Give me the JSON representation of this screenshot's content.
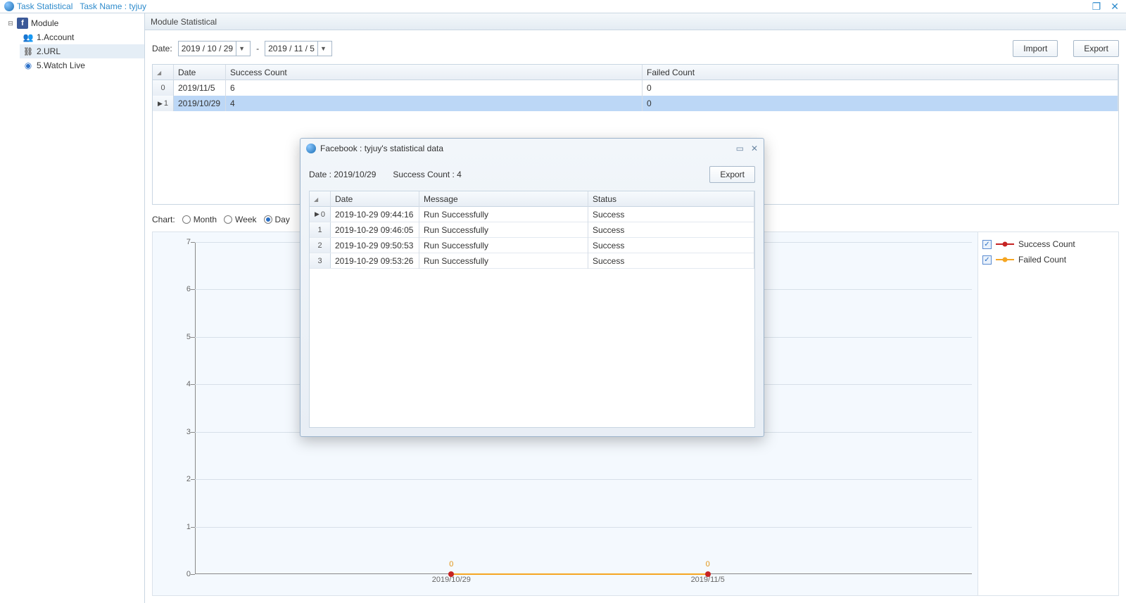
{
  "titlebar": {
    "app": "Task Statistical",
    "task_label": "Task Name : tyjuy"
  },
  "sidebar": {
    "root_label": "Module",
    "items": [
      {
        "label": "1.Account",
        "icon": "users"
      },
      {
        "label": "2.URL",
        "icon": "url"
      },
      {
        "label": "5.Watch Live",
        "icon": "watch"
      }
    ]
  },
  "panel": {
    "heading": "Module Statistical",
    "date_label": "Date:",
    "date_from": "2019 / 10 / 29",
    "date_to": "2019 / 11 / 5",
    "date_sep": "-",
    "import_btn": "Import",
    "export_btn": "Export"
  },
  "summary_table": {
    "columns": {
      "date": "Date",
      "success": "Success Count",
      "failed": "Failed Count"
    },
    "rows": [
      {
        "date": "2019/11/5",
        "success": "6",
        "failed": "0"
      },
      {
        "date": "2019/10/29",
        "success": "4",
        "failed": "0"
      }
    ],
    "selected_row": 1
  },
  "chart_controls": {
    "label": "Chart:",
    "options": [
      "Month",
      "Week",
      "Day"
    ],
    "selected": "Day"
  },
  "legend": {
    "items": [
      {
        "label": "Success Count",
        "color": "red",
        "checked": true
      },
      {
        "label": "Failed Count",
        "color": "orng",
        "checked": true
      }
    ]
  },
  "dialog": {
    "title": "Facebook : tyjuy's statistical data",
    "date_line": "Date : 2019/10/29",
    "succ_line": "Success Count : 4",
    "export_btn": "Export",
    "columns": {
      "date": "Date",
      "msg": "Message",
      "status": "Status"
    },
    "rows": [
      {
        "date": "2019-10-29 09:44:16",
        "msg": "Run Successfully",
        "status": "Success"
      },
      {
        "date": "2019-10-29 09:46:05",
        "msg": "Run Successfully",
        "status": "Success"
      },
      {
        "date": "2019-10-29 09:50:53",
        "msg": "Run Successfully",
        "status": "Success"
      },
      {
        "date": "2019-10-29 09:53:26",
        "msg": "Run Successfully",
        "status": "Success"
      }
    ]
  },
  "chart_data": {
    "type": "line",
    "categories": [
      "2019/10/29",
      "2019/11/5"
    ],
    "series": [
      {
        "name": "Success Count",
        "values": [
          4,
          6
        ],
        "color": "red",
        "hidden_in_view": true
      },
      {
        "name": "Failed Count",
        "values": [
          0,
          0
        ],
        "color": "orng"
      }
    ],
    "ylim": [
      0,
      7
    ],
    "yticks": [
      0,
      1,
      2,
      3,
      4,
      5,
      6,
      7
    ],
    "point_labels_visible": [
      {
        "series": "Failed Count",
        "category": "2019/10/29",
        "label": "0"
      },
      {
        "series": "Failed Count",
        "category": "2019/11/5",
        "label": "0"
      }
    ]
  }
}
